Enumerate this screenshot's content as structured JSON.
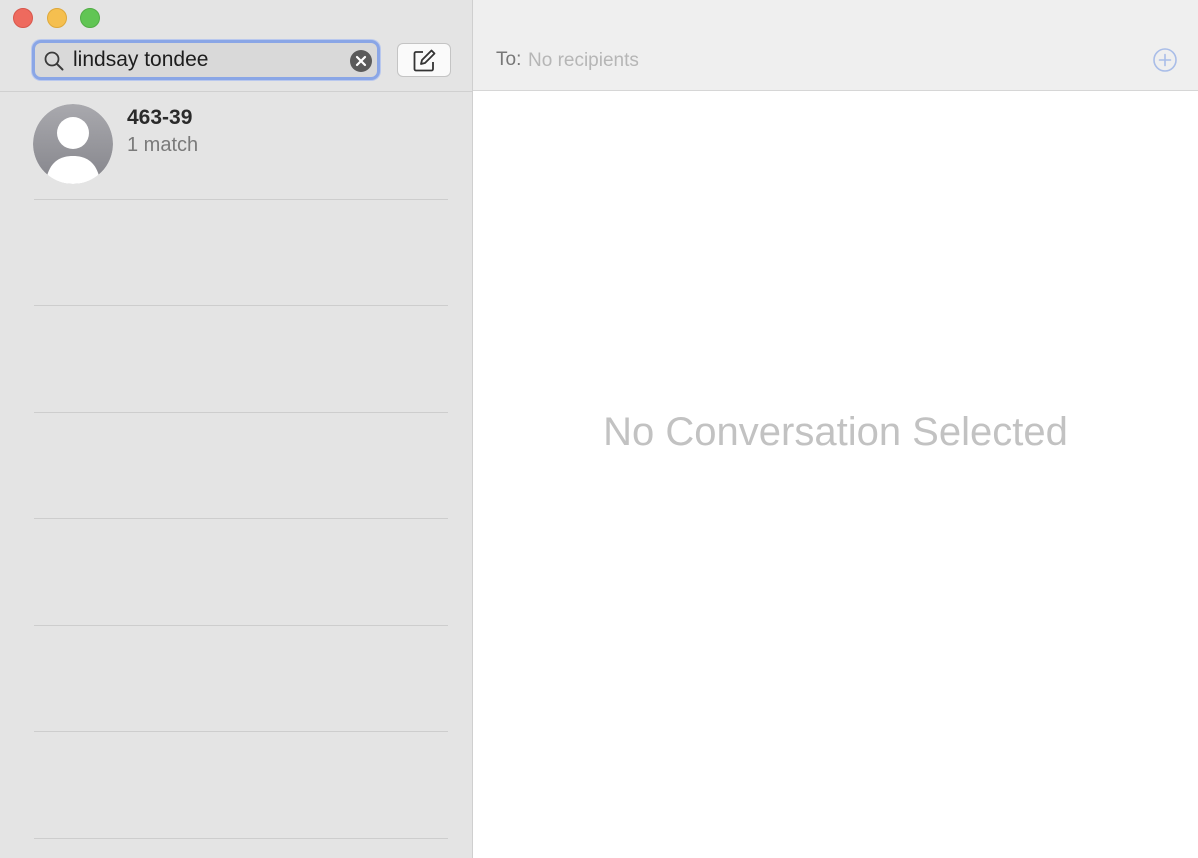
{
  "window": {
    "controls": [
      "close",
      "minimize",
      "zoom"
    ]
  },
  "sidebar": {
    "search": {
      "value": "lindsay tondee",
      "placeholder": "Search",
      "icon": "magnifier-icon",
      "clear_icon": "clear-x-icon"
    },
    "compose_icon": "compose-pencil-icon",
    "conversations": [
      {
        "name": "463-39",
        "subtitle": "1 match",
        "avatar_icon": "person-silhouette-icon"
      }
    ]
  },
  "main": {
    "to_label": "To:",
    "recipients_placeholder": "No recipients",
    "add_icon": "plus-circle-icon",
    "empty_message": "No Conversation Selected"
  },
  "colors": {
    "sidebar_bg": "#e4e4e4",
    "focus_ring": "#8aa6e6",
    "accent": "#a9bde8",
    "close": "#ee6a5e",
    "minimize": "#f5bf4f",
    "zoom": "#61c554",
    "placeholder": "#b6b6b6"
  }
}
